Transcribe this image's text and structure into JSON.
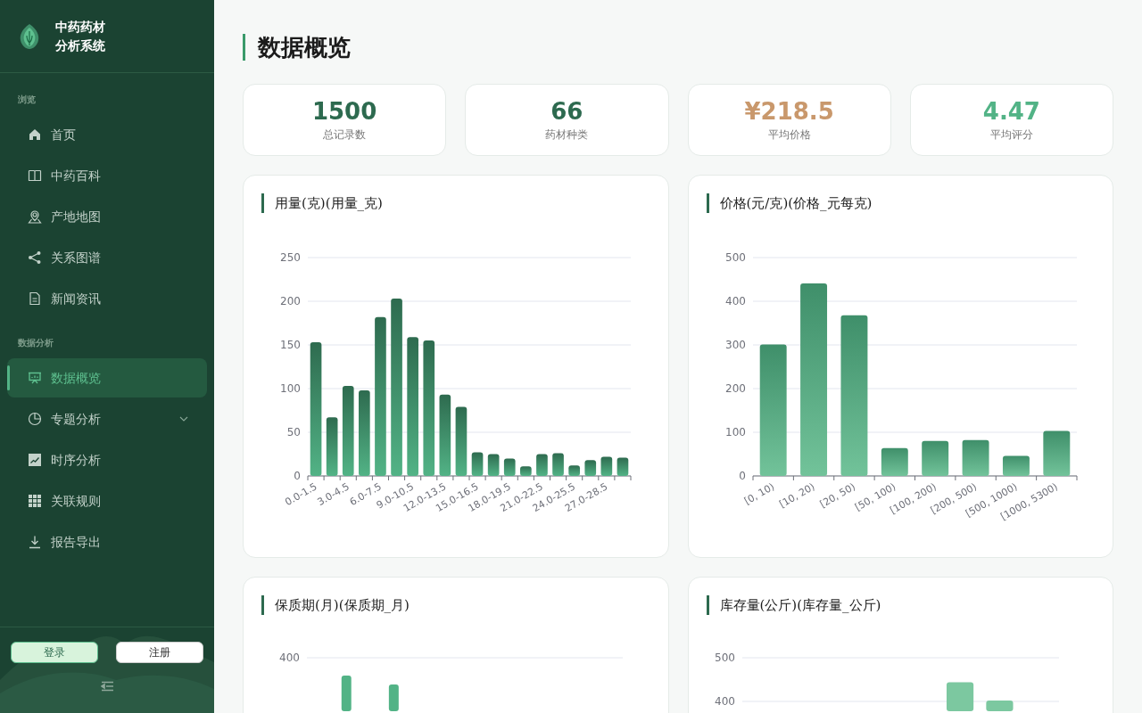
{
  "sidebar": {
    "app_title_lines": [
      "中药药材",
      "分析系统"
    ],
    "sections": [
      {
        "label": "浏览",
        "items": [
          {
            "label": "首页",
            "selected": false,
            "expandable": false
          },
          {
            "label": "中药百科",
            "selected": false,
            "expandable": false
          },
          {
            "label": "产地地图",
            "selected": false,
            "expandable": false
          },
          {
            "label": "关系图谱",
            "selected": false,
            "expandable": false
          },
          {
            "label": "新闻资讯",
            "selected": false,
            "expandable": false
          }
        ]
      },
      {
        "label": "数据分析",
        "items": [
          {
            "label": "数据概览",
            "selected": true,
            "expandable": false
          },
          {
            "label": "专题分析",
            "selected": false,
            "expandable": true
          },
          {
            "label": "时序分析",
            "selected": false,
            "expandable": false
          },
          {
            "label": "关联规则",
            "selected": false,
            "expandable": false
          },
          {
            "label": "报告导出",
            "selected": false,
            "expandable": false
          }
        ]
      }
    ],
    "buttons": [
      {
        "label": "登录",
        "kind": "primary"
      },
      {
        "label": "注册",
        "kind": "secondary"
      }
    ]
  },
  "page_title": "数据概览",
  "stats": [
    {
      "value": "1500",
      "label": "总记录数",
      "color": "#2d6a4f"
    },
    {
      "value": "66",
      "label": "药材种类",
      "color": "#2d6a4f"
    },
    {
      "value": "¥218.5",
      "label": "平均价格",
      "color": "#c9986c"
    },
    {
      "value": "4.47",
      "label": "平均评分",
      "color": "#52b386"
    }
  ],
  "charts": [
    {
      "chart_data": {
        "type": "bar",
        "title": "用量(克)(用量_克)",
        "categories": [
          "0.0-1.5",
          null,
          "3.0-4.5",
          null,
          "6.0-7.5",
          null,
          "9.0-10.5",
          null,
          "12.0-13.5",
          null,
          "15.0-16.5",
          null,
          "18.0-19.5",
          null,
          "21.0-22.5",
          null,
          "24.0-25.5",
          null,
          "27.0-28.5",
          null
        ],
        "values": [
          153,
          67,
          103,
          98,
          182,
          203,
          159,
          155,
          93,
          79,
          27,
          25,
          20,
          11,
          25,
          26,
          12,
          18,
          22,
          21
        ],
        "ylim": [
          0,
          250
        ],
        "yticks": [
          0,
          50,
          100,
          150,
          200,
          250
        ],
        "grid": true
      }
    },
    {
      "chart_data": {
        "type": "bar",
        "title": "价格(元/克)(价格_元每克)",
        "categories": [
          "[0, 10)",
          "[10, 20)",
          "[20, 50)",
          "[50, 100)",
          "[100, 200)",
          "[200, 500)",
          "[500, 1000)",
          "[1000, 5300)"
        ],
        "values": [
          301,
          441,
          368,
          64,
          80,
          82,
          46,
          103
        ],
        "ylim": [
          0,
          500
        ],
        "yticks": [
          0,
          100,
          200,
          300,
          400,
          500
        ],
        "grid": true
      }
    },
    {
      "title": "保质期(月)(保质期_月)",
      "axis_labels": [
        "400"
      ]
    },
    {
      "title": "库存量(公斤)(库存量_公斤)",
      "axis_labels": [
        "500",
        "400"
      ]
    }
  ]
}
